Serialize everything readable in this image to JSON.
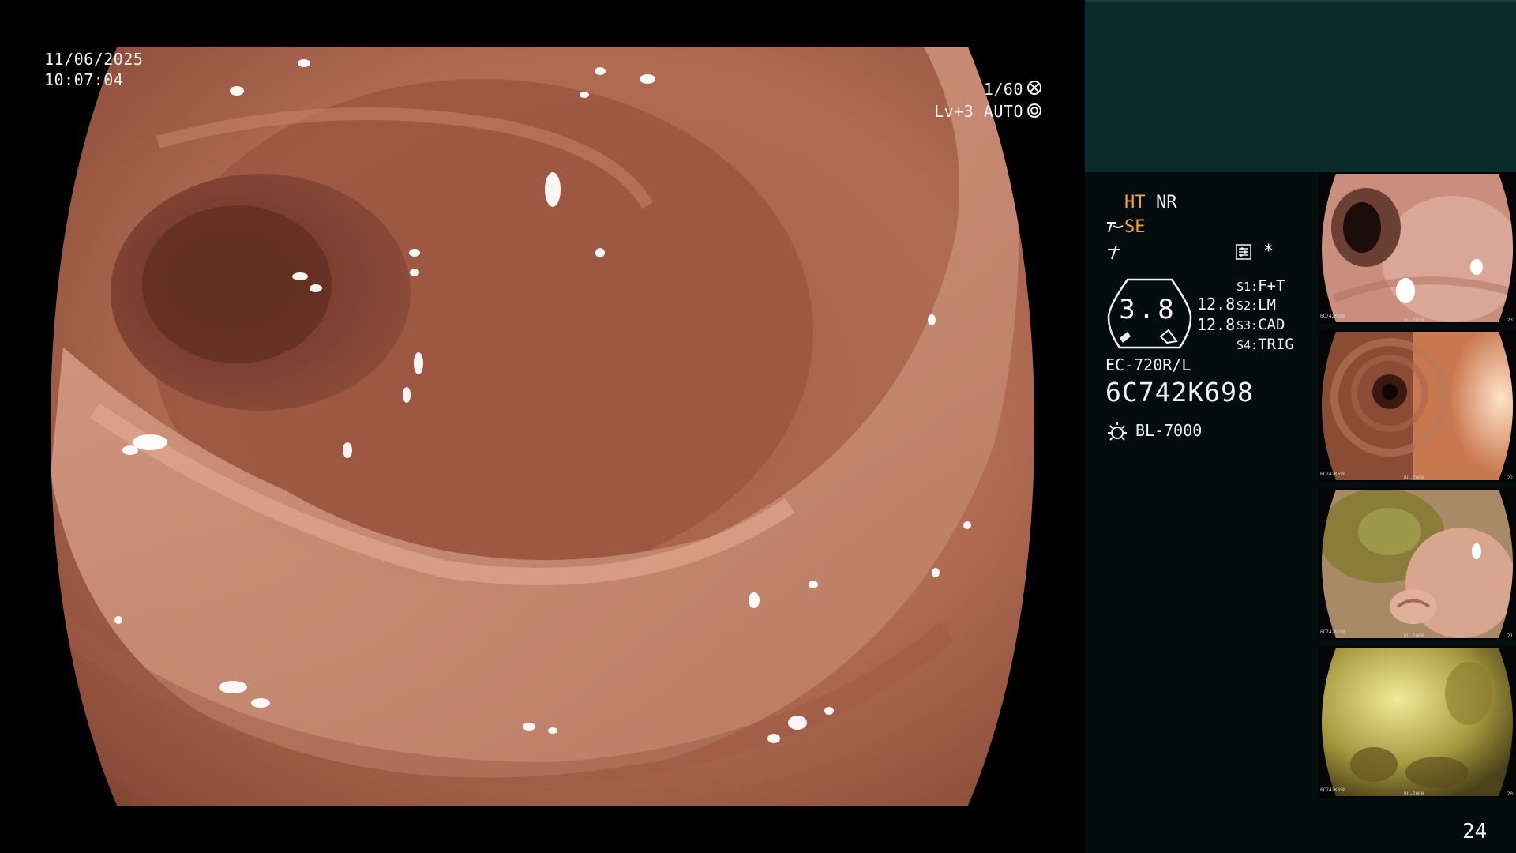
{
  "overlay": {
    "date": "11/06/2025",
    "time": "10:07:04",
    "shutter": "1/60",
    "shutter_icon": "aperture-icon",
    "level": "Lv+3 AUTO",
    "level_icon": "auto-iris-icon"
  },
  "panel": {
    "ht_label": "HT",
    "nr_label": "NR",
    "se_label": "SE",
    "se_icon": "structure-enhance-icon",
    "f_icon": "freeze-icon",
    "menu_icon": "settings-icon",
    "star_label": "*",
    "gauge_value": "3.8",
    "gauge_val1": "12.8",
    "gauge_val2": "12.8",
    "slots": [
      {
        "key": "S1:",
        "value": "F+T"
      },
      {
        "key": "S2:",
        "value": "LM"
      },
      {
        "key": "S3:",
        "value": "CAD"
      },
      {
        "key": "S4:",
        "value": "TRIG"
      }
    ],
    "scope_model": "EC-720R/L",
    "serial": "6C742K698",
    "light_icon": "light-source-icon",
    "light_source": "BL-7000",
    "page_number": "24",
    "accent_color": "#f2a33a",
    "panel_top_color": "#0b2a2a"
  },
  "thumbnails": [
    {
      "serial": "6C742K698",
      "light": "BL-7000",
      "number": "23",
      "scene": "lumen-left"
    },
    {
      "serial": "6C742K698",
      "light": "BL-7000",
      "number": "22",
      "scene": "tunnel"
    },
    {
      "serial": "6C742K698",
      "light": "BL-7000",
      "number": "21",
      "scene": "stool-fold"
    },
    {
      "serial": "6C742K698",
      "light": "BL-7000",
      "number": "20",
      "scene": "yellow-fluid"
    }
  ]
}
